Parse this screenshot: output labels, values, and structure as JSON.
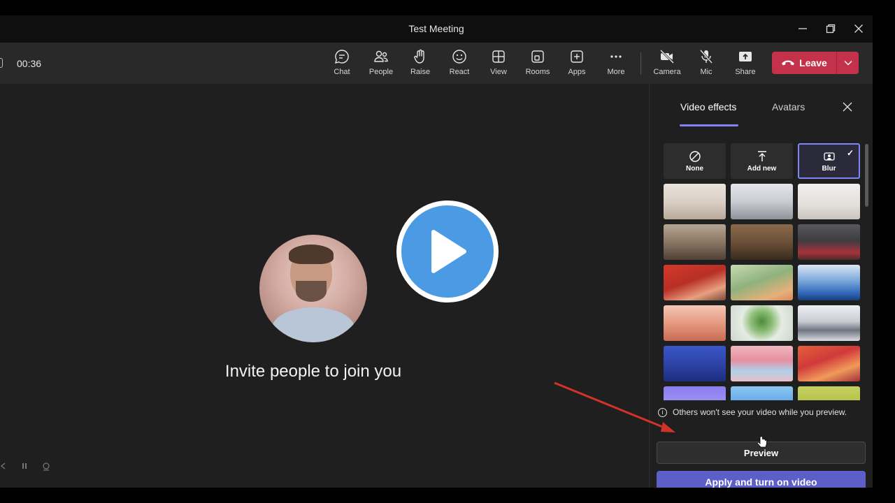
{
  "window": {
    "title": "Test Meeting"
  },
  "toolbar": {
    "timer": "00:36",
    "buttons": [
      {
        "label": "Chat",
        "icon": "chat-icon"
      },
      {
        "label": "People",
        "icon": "people-icon"
      },
      {
        "label": "Raise",
        "icon": "raise-hand-icon"
      },
      {
        "label": "React",
        "icon": "smiley-icon"
      },
      {
        "label": "View",
        "icon": "grid-view-icon"
      },
      {
        "label": "Rooms",
        "icon": "rooms-icon"
      },
      {
        "label": "Apps",
        "icon": "plus-box-icon"
      },
      {
        "label": "More",
        "icon": "more-icon"
      },
      {
        "label": "Camera",
        "icon": "camera-off-icon"
      },
      {
        "label": "Mic",
        "icon": "mic-off-icon"
      },
      {
        "label": "Share",
        "icon": "share-icon"
      }
    ],
    "leave_label": "Leave"
  },
  "stage": {
    "invite_text": "Invite people to join you"
  },
  "panel": {
    "tabs": [
      {
        "label": "Video effects",
        "active": true
      },
      {
        "label": "Avatars",
        "active": false
      }
    ],
    "options": [
      {
        "label": "None",
        "icon": "none-circle-icon"
      },
      {
        "label": "Add new",
        "icon": "upload-icon"
      },
      {
        "label": "Blur",
        "icon": "blur-icon",
        "selected": true
      }
    ],
    "info_text": "Others won't see your video while you preview.",
    "preview_label": "Preview",
    "apply_label": "Apply and turn on video"
  },
  "colors": {
    "accent": "#7f85f5",
    "apply": "#5b5fc7",
    "leave": "#c4314b",
    "play": "#4a9be3"
  }
}
